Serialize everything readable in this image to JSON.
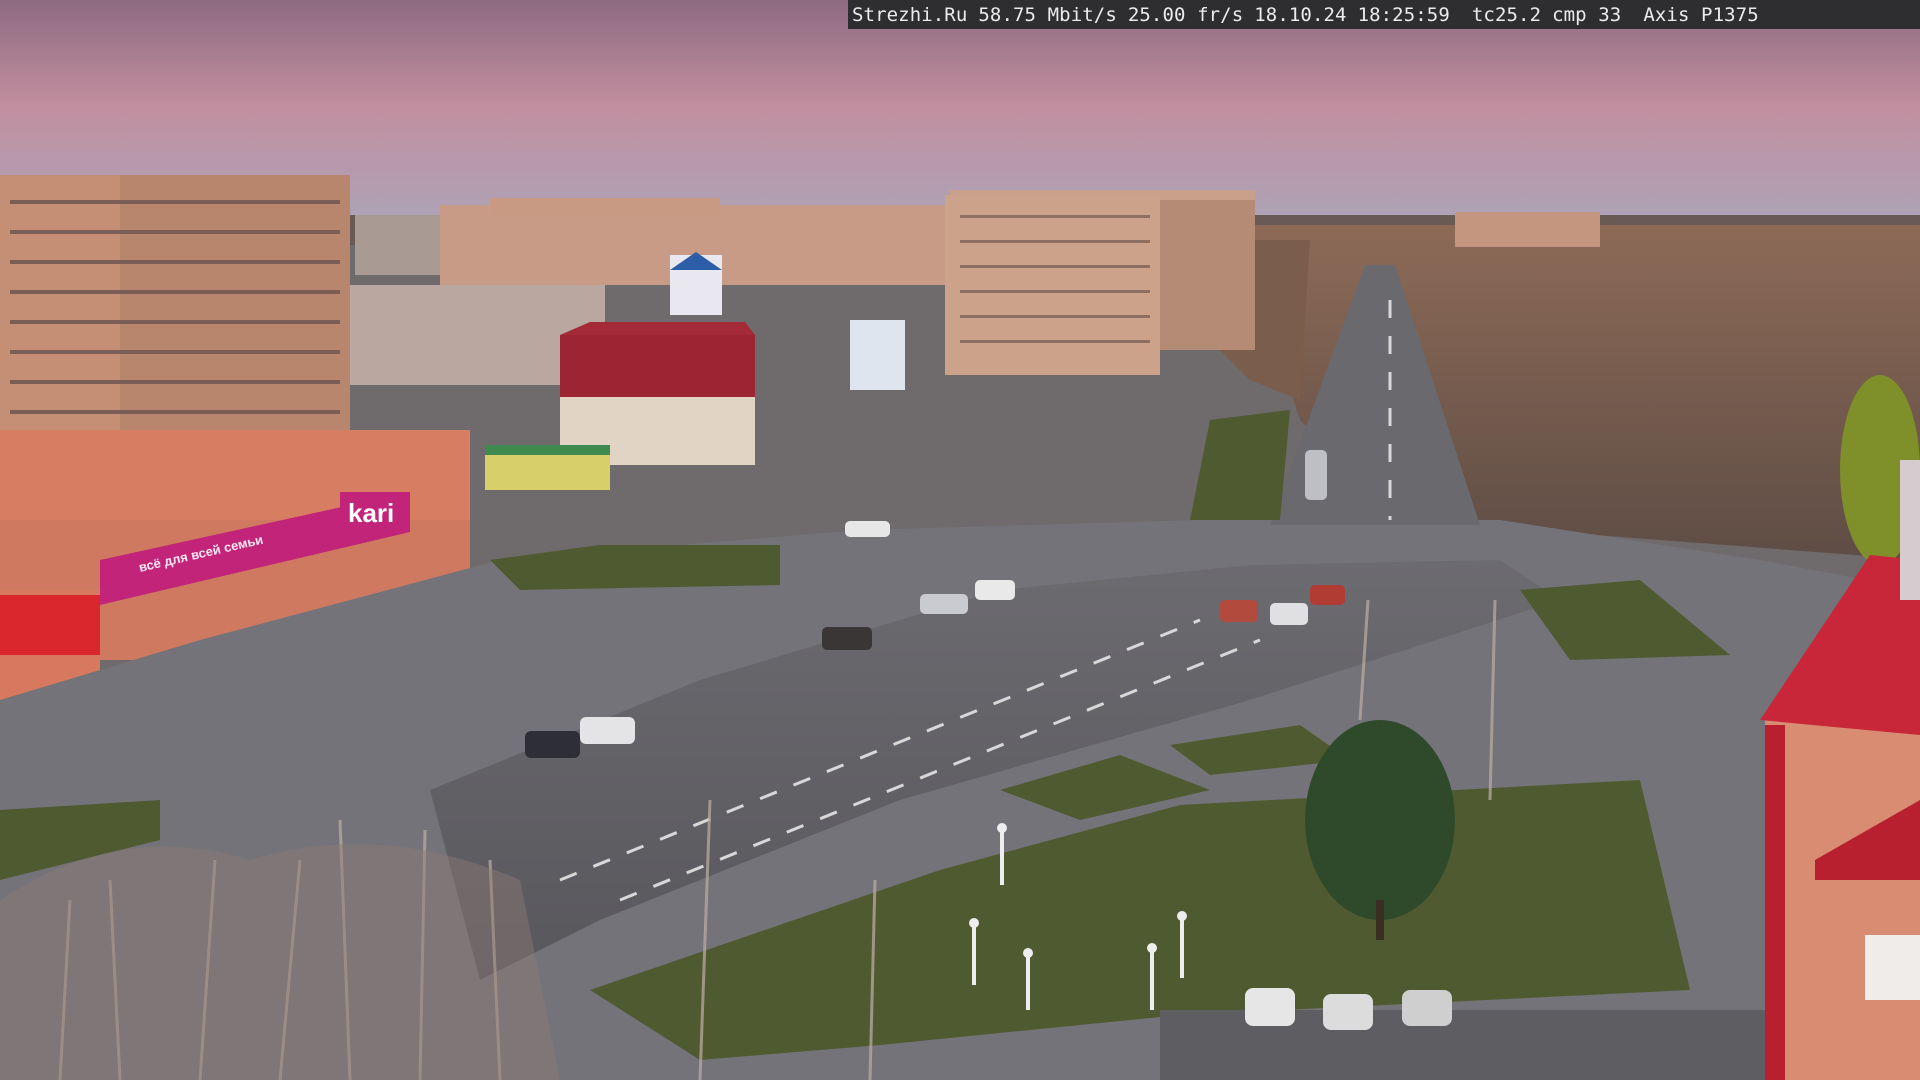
{
  "camera_overlay": {
    "site": "Strezhi.Ru",
    "bitrate": "58.75 Mbit/s",
    "framerate": "25.00 fr/s",
    "date": "18.10.24",
    "time": "18:25:59",
    "tc": "tc25.2",
    "cmp": "cmp 33",
    "camera_model": "Axis P1375"
  },
  "scene": {
    "store_sign": "kari",
    "store_banner": "всё для всей семьи",
    "colors": {
      "sky_top": "#b9869a",
      "sky_bottom": "#a9a3b6",
      "buildings": "#c99a7e",
      "road": "#5f5e63",
      "grass": "#4b5a33",
      "kari_magenta": "#c2247a"
    }
  }
}
